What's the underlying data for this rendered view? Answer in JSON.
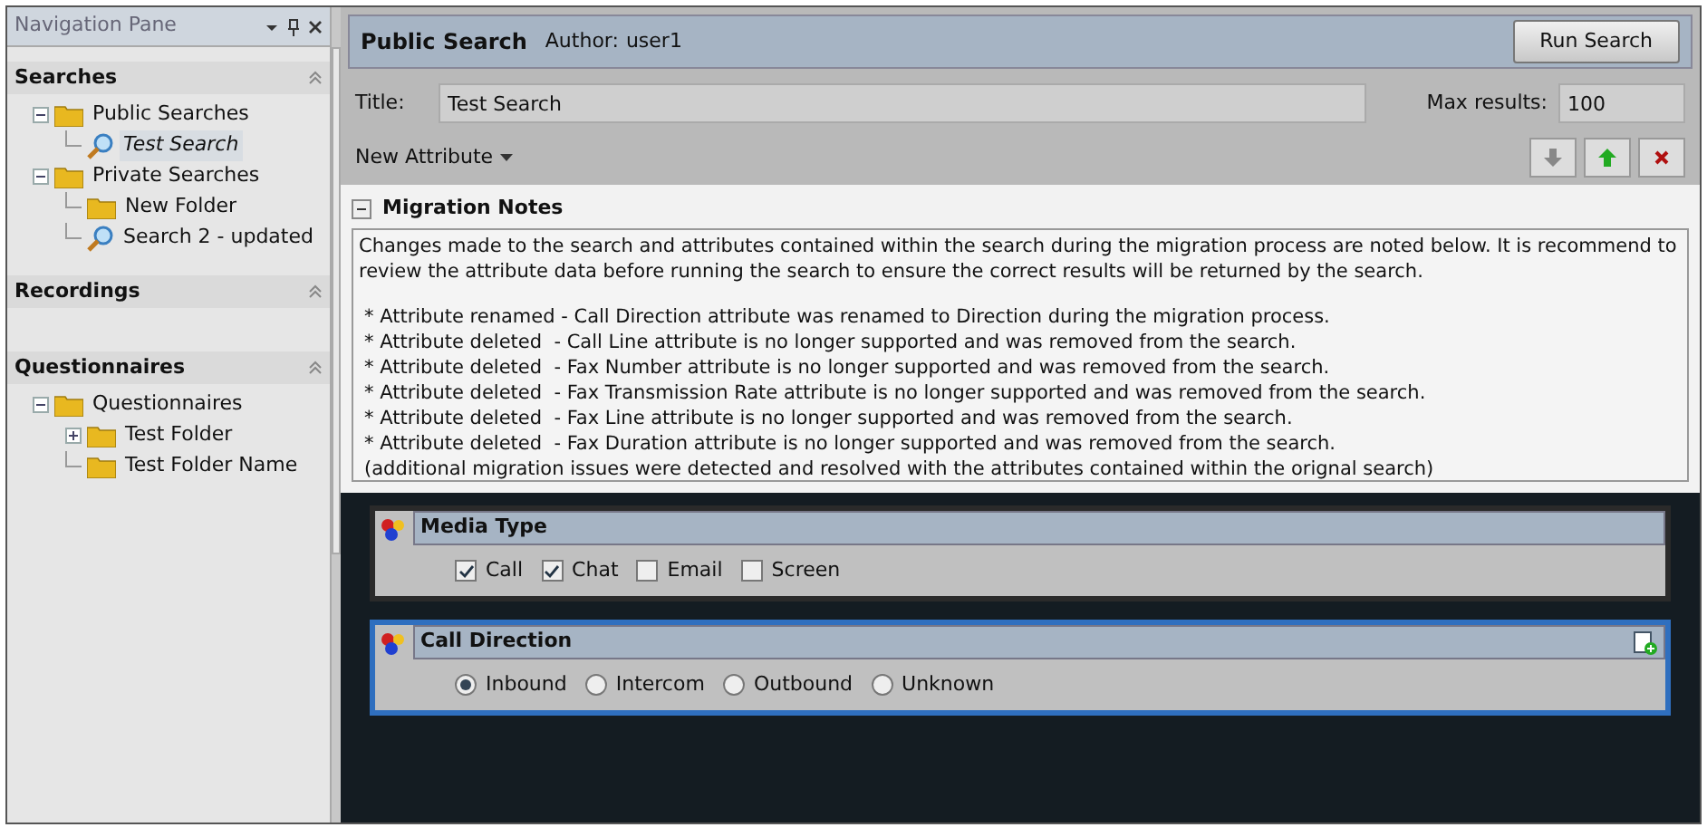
{
  "nav": {
    "title": "Navigation Pane",
    "sections": [
      {
        "title": "Searches",
        "tree": [
          {
            "label": "Public Searches",
            "kind": "folder",
            "expanded": true,
            "selected": false,
            "children": [
              {
                "label": "Test Search",
                "kind": "search",
                "selected": true
              }
            ]
          },
          {
            "label": "Private Searches",
            "kind": "folder",
            "expanded": true,
            "selected": false,
            "children": [
              {
                "label": "New Folder",
                "kind": "folder",
                "selected": false
              },
              {
                "label": "Search 2 - updated",
                "kind": "search",
                "selected": false
              }
            ]
          }
        ]
      },
      {
        "title": "Recordings"
      },
      {
        "title": "Questionnaires",
        "tree": [
          {
            "label": "Questionnaires",
            "kind": "folder",
            "expanded": true,
            "selected": false,
            "children": [
              {
                "label": "Test Folder",
                "kind": "folder",
                "expanded": false,
                "selected": false
              },
              {
                "label": "Test Folder Name",
                "kind": "folder",
                "selected": false
              }
            ]
          }
        ]
      }
    ]
  },
  "search": {
    "title": "Public Search",
    "author_label": "Author:",
    "author": "user1",
    "run_button": "Run Search",
    "title_label": "Title:",
    "title_value": "Test Search",
    "max_label": "Max results:",
    "max_value": "100",
    "new_attribute": "New Attribute"
  },
  "notes": {
    "title": "Migration Notes",
    "expanded": true,
    "intro": "Changes made to the search and attributes contained within the search during the migration process are noted below.  It is recommend to review the attribute data before running the search to ensure the correct results will be returned by the search.",
    "items": [
      "* Attribute renamed - Call Direction attribute was renamed to Direction during the migration process.",
      "* Attribute deleted  - Call Line attribute is no longer supported and was removed from the search.",
      "* Attribute deleted  - Fax Number attribute is no longer supported and was removed from the search.",
      "* Attribute deleted  - Fax Transmission Rate attribute is no longer supported and was removed from the search.",
      "* Attribute deleted  - Fax Line attribute is no longer supported and was removed from the search.",
      "* Attribute deleted  - Fax Duration attribute is no longer supported and was removed from the search."
    ],
    "footer": "(additional migration issues were detected and resolved with the attributes contained within the orignal search)"
  },
  "attributes": [
    {
      "kind": "checkbox",
      "title": "Media Type",
      "focused": false,
      "options": [
        {
          "label": "Call",
          "checked": true
        },
        {
          "label": "Chat",
          "checked": true
        },
        {
          "label": "Email",
          "checked": false
        },
        {
          "label": "Screen",
          "checked": false
        }
      ]
    },
    {
      "kind": "radio",
      "title": "Call Direction",
      "focused": true,
      "options": [
        {
          "label": "Inbound",
          "selected": true
        },
        {
          "label": "Intercom",
          "selected": false
        },
        {
          "label": "Outbound",
          "selected": false
        },
        {
          "label": "Unknown",
          "selected": false
        }
      ]
    }
  ]
}
